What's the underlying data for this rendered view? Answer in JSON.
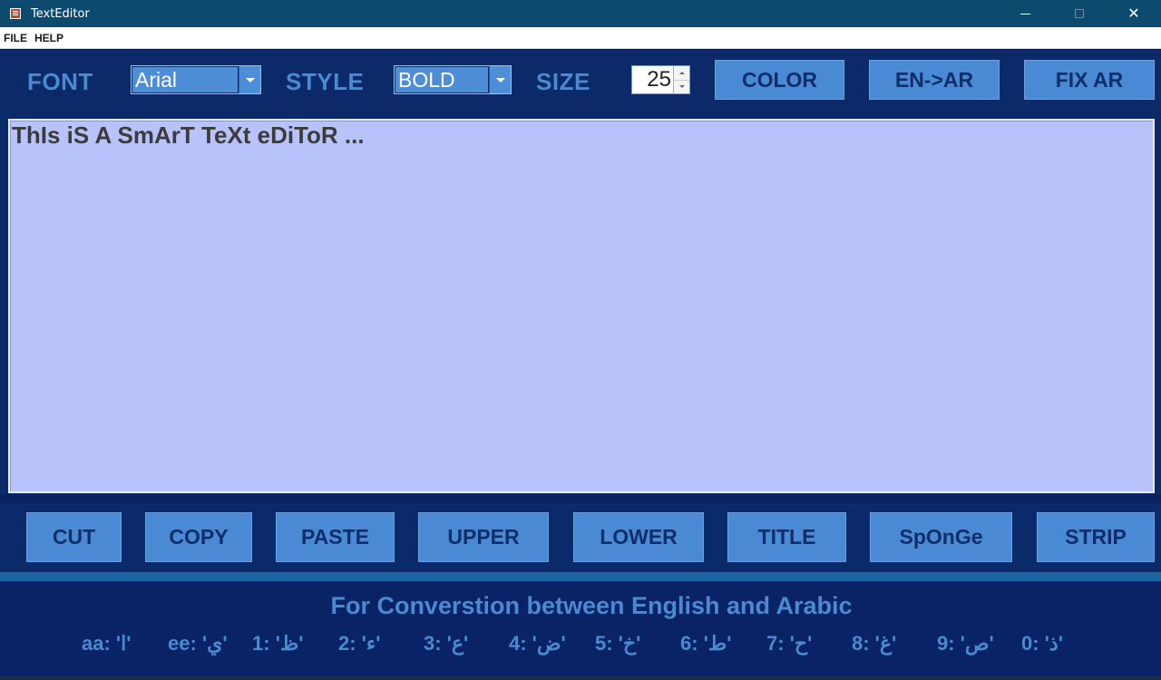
{
  "window": {
    "title": "TextEditor",
    "minimize_symbol": "—",
    "close_symbol": "✕"
  },
  "menu": {
    "items": [
      "FILE",
      "HELP"
    ]
  },
  "toolbar": {
    "font_label": "FONT",
    "font_value": "Arial",
    "style_label": "STYLE",
    "style_value": "BOLD",
    "size_label": "SIZE",
    "size_value": "25",
    "color_button": "COLOR",
    "en_ar_button": "EN->AR",
    "fix_ar_button": "FIX AR"
  },
  "editor": {
    "text": "ThIs iS A SmArT TeXt eDiToR ...",
    "background_color": "#b8c3fc"
  },
  "actions": {
    "cut": "CUT",
    "copy": "COPY",
    "paste": "PASTE",
    "upper": "UPPER",
    "lower": "LOWER",
    "title": "TITLE",
    "sponge": "SpOnGe",
    "strip": "STRIP"
  },
  "footer": {
    "title": "For Converstion between English and Arabic",
    "mappings": [
      "aa: 'ا'",
      "ee: 'ي'",
      "1: 'ظ'",
      "2: 'ء'",
      "3: 'ع'",
      "4: 'ض'",
      "5: 'خ'",
      "6: 'ط'",
      "7: 'ح'",
      "8: 'غ'",
      "9: 'ص'",
      "0: 'ذ'"
    ]
  },
  "colors": {
    "accent": "#4a8ad4",
    "panel": "#0c2a6a",
    "titlebar": "#0d4a6e"
  }
}
